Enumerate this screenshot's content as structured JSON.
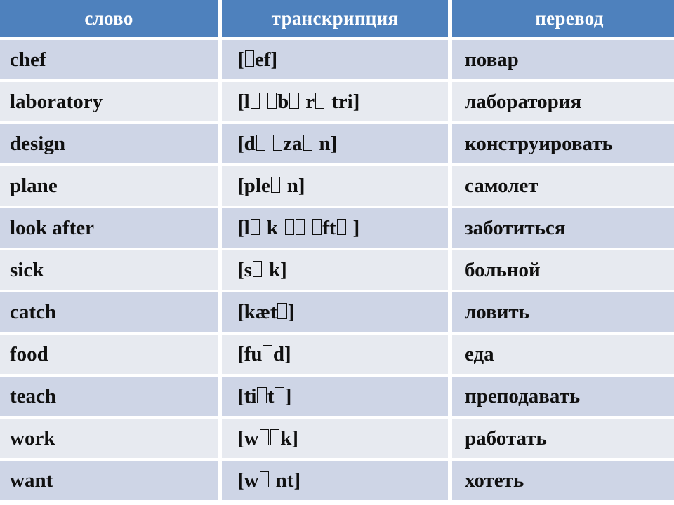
{
  "table": {
    "headers": {
      "word": "слово",
      "transcription": "транскрипция",
      "translation": "перевод"
    },
    "header_bg": "#4e81bd",
    "header_text_color": "#ffffff",
    "row_bg_odd": "#ced5e6",
    "row_bg_even": "#e7eaf0",
    "rows": [
      {
        "word": "chef",
        "transcription": "[ʃef]",
        "transcription_tofu": "[□ef]",
        "translation": "повар"
      },
      {
        "word": "laboratory",
        "transcription": "[ləˈbɒrətri]",
        "transcription_tofu": "[l□ □b□ r□ tri]",
        "translation": "лаборатория"
      },
      {
        "word": "design",
        "transcription": "[dɪˈzaɪn]",
        "transcription_tofu": "[d□ □za□ n]",
        "translation": "конструировать"
      },
      {
        "word": "plane",
        "transcription": "[pleɪn]",
        "transcription_tofu": "[ple□ n]",
        "translation": "самолет"
      },
      {
        "word": "look after",
        "transcription": "[lʊk ˌɑːftə]",
        "transcription_tofu": "[l□ k □□ □ft□ ]",
        "translation": "заботиться"
      },
      {
        "word": "sick",
        "transcription": "[sɪk]",
        "transcription_tofu": "[s□ k]",
        "translation": "больной"
      },
      {
        "word": "catch",
        "transcription": "[kætʃ]",
        "transcription_tofu": "[kæt□]",
        "translation": "ловить"
      },
      {
        "word": "food",
        "transcription": "[fuːd]",
        "transcription_tofu": "[fu□d]",
        "translation": "еда"
      },
      {
        "word": "teach",
        "transcription": "[tiːtʃ]",
        "transcription_tofu": "[ti□t□]",
        "translation": "преподавать"
      },
      {
        "word": "work",
        "transcription": "[wɜːk]",
        "transcription_tofu": "[w□□k]",
        "translation": "работать"
      },
      {
        "word": "want",
        "transcription": "[wɒnt]",
        "transcription_tofu": "[w□ nt]",
        "translation": "хотеть"
      }
    ]
  }
}
